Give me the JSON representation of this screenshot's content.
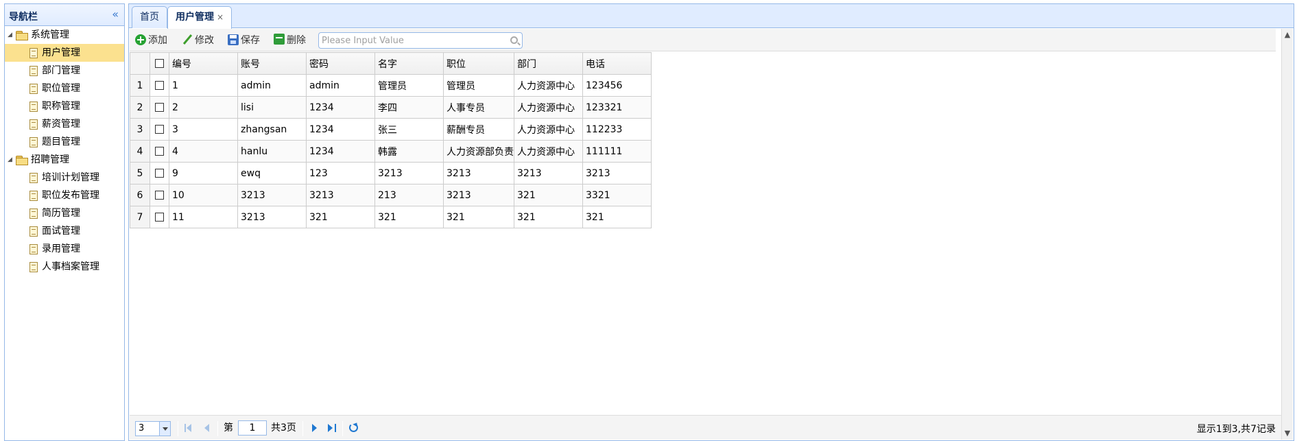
{
  "nav": {
    "title": "导航栏",
    "collapse_glyph": "«",
    "groups": [
      {
        "label": "系统管理",
        "items": [
          {
            "label": "用户管理"
          },
          {
            "label": "部门管理"
          },
          {
            "label": "职位管理"
          },
          {
            "label": "职称管理"
          },
          {
            "label": "薪资管理"
          },
          {
            "label": "题目管理"
          }
        ]
      },
      {
        "label": "招聘管理",
        "items": [
          {
            "label": "培训计划管理"
          },
          {
            "label": "职位发布管理"
          },
          {
            "label": "简历管理"
          },
          {
            "label": "面试管理"
          },
          {
            "label": "录用管理"
          },
          {
            "label": "人事档案管理"
          }
        ]
      }
    ]
  },
  "tabs": [
    {
      "label": "首页"
    },
    {
      "label": "用户管理",
      "close": "×"
    }
  ],
  "toolbar": {
    "add": "添加",
    "edit": "修改",
    "save": "保存",
    "delete": "删除",
    "search_placeholder": "Please Input Value"
  },
  "grid": {
    "columns": [
      "编号",
      "账号",
      "密码",
      "名字",
      "职位",
      "部门",
      "电话"
    ],
    "rows": [
      {
        "n": "1",
        "cells": [
          "1",
          "admin",
          "admin",
          "管理员",
          "管理员",
          "人力资源中心",
          "123456"
        ]
      },
      {
        "n": "2",
        "cells": [
          "2",
          "lisi",
          "1234",
          "李四",
          "人事专员",
          "人力资源中心",
          "123321"
        ]
      },
      {
        "n": "3",
        "cells": [
          "3",
          "zhangsan",
          "1234",
          "张三",
          "薪酬专员",
          "人力资源中心",
          "112233"
        ]
      },
      {
        "n": "4",
        "cells": [
          "4",
          "hanlu",
          "1234",
          "韩露",
          "人力资源部负责",
          "人力资源中心",
          "111111"
        ]
      },
      {
        "n": "5",
        "cells": [
          "9",
          "ewq",
          "123",
          "3213",
          "3213",
          "3213",
          "3213"
        ]
      },
      {
        "n": "6",
        "cells": [
          "10",
          "3213",
          "3213",
          "213",
          "3213",
          "321",
          "3321"
        ]
      },
      {
        "n": "7",
        "cells": [
          "11",
          "3213",
          "321",
          "321",
          "321",
          "321",
          "321"
        ]
      }
    ]
  },
  "pager": {
    "page_size": "3",
    "page_prefix": "第",
    "page_value": "1",
    "page_suffix": "共3页",
    "info": "显示1到3,共7记录"
  },
  "colors": {
    "border": "#95b8e7",
    "header_bg": "#e0ecff",
    "selected_bg": "#fbe18f",
    "accent": "#1f78d1"
  }
}
